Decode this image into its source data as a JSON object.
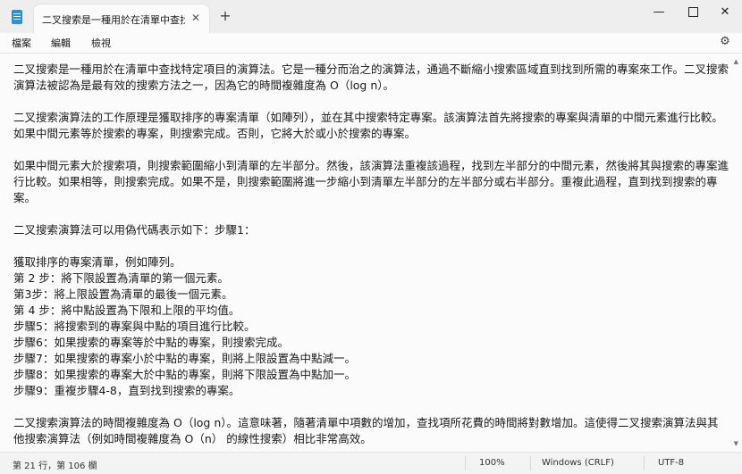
{
  "window": {
    "tab_title": "二叉搜索是一種用於在清單中查找特",
    "tab_close": "✕",
    "new_tab": "+",
    "minimize": "—",
    "close": "✕"
  },
  "menu": {
    "file": "檔案",
    "edit": "編輯",
    "view": "檢視"
  },
  "icons": {
    "app": "notepad-icon",
    "settings": "gear-icon",
    "settings_glyph": "⚙"
  },
  "document": {
    "lines": [
      "二叉搜索是一種用於在清單中查找特定項目的演算法。它是一種分而治之的演算法，通過不斷縮小搜索區域直到找到所需的專案來工作。二叉搜索演算法被認為是最有效的搜索方法之一，因為它的時間複雜度為 O（log n）。",
      "",
      "二叉搜索演算法的工作原理是獲取排序的專案清單（如陣列），並在其中搜索特定專案。該演算法首先將搜索的專案與清單的中間元素進行比較。如果中間元素等於搜索的專案，則搜索完成。否則，它將大於或小於搜索的專案。",
      "",
      "如果中間元素大於搜索項，則搜索範圍縮小到清單的左半部分。然後，該演算法重複該過程，找到左半部分的中間元素，然後將其與搜索的專案進行比較。如果相等，則搜索完成。如果不是，則搜索範圍將進一步縮小到清單左半部分的左半部分或右半部分。重複此過程，直到找到搜索的專案。",
      "",
      "二叉搜索演算法可以用偽代碼表示如下：步驟1：",
      "",
      "獲取排序的專案清單，例如陣列。",
      "第 2 步：將下限設置為清單的第一個元素。",
      "第3步：將上限設置為清單的最後一個元素。",
      "第 4 步：將中點設置為下限和上限的平均值。",
      "步驟5：將搜索到的專案與中點的項目進行比較。",
      "步驟6：如果搜索的專案等於中點的專案，則搜索完成。",
      "步驟7：如果搜索的專案小於中點的專案，則將上限設置為中點減一。",
      "步驟8：如果搜索的專案大於中點的專案，則將下限設置為中點加一。",
      "步驟9：重複步驟4-8，直到找到搜索的專案。",
      "",
      "二叉搜索演算法的時間複雜度為 O（log n）。這意味著，隨著清單中項數的增加，查找項所花費的時間將對數增加。這使得二叉搜索演算法與其他搜索演算法（例如時間複雜度為 O（n） 的線性搜索）相比非常高效。"
    ]
  },
  "status": {
    "position": "第 21 行，第 106 欄",
    "zoom": "100%",
    "line_ending": "Windows (CRLF)",
    "encoding": "UTF-8"
  }
}
